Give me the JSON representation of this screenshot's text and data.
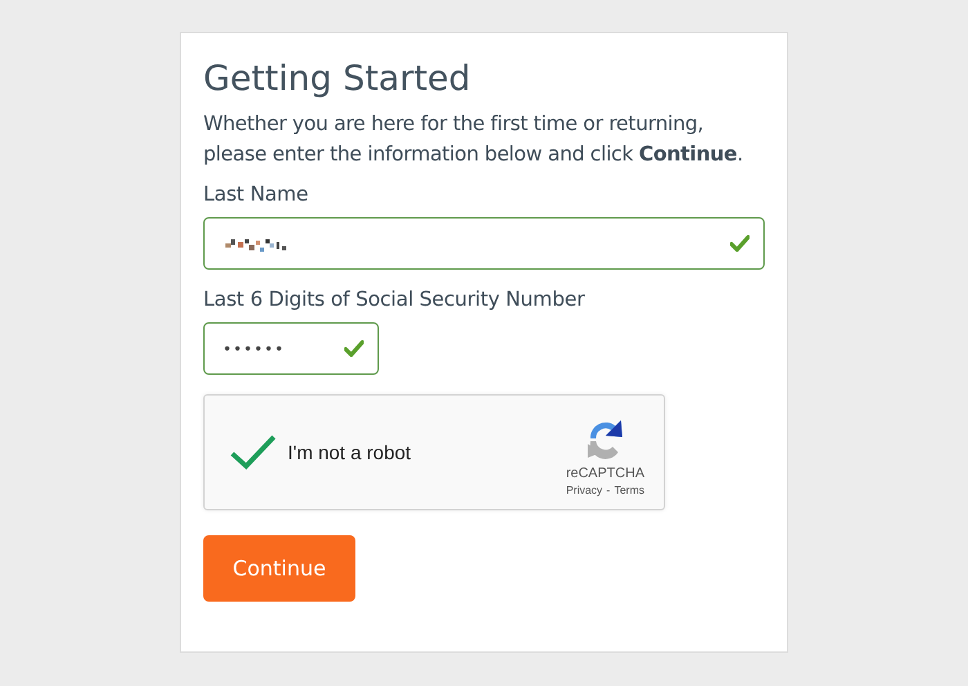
{
  "title": "Getting Started",
  "intro": "Whether you are here for the first time or returning, please enter the information below and click **Continue**.",
  "fields": [
    {
      "label": "Last Name",
      "value_obscured": true,
      "valid": true,
      "kind": "text"
    },
    {
      "label": "Last 6 Digits of Social Security Number",
      "value": "••••••",
      "valid": true,
      "kind": "password"
    }
  ],
  "captcha": {
    "label": "I'm not a robot",
    "checked": true,
    "brand": "reCAPTCHA",
    "links": [
      "Privacy",
      "Terms"
    ],
    "separator": "-"
  },
  "buttons": [
    "Continue"
  ]
}
